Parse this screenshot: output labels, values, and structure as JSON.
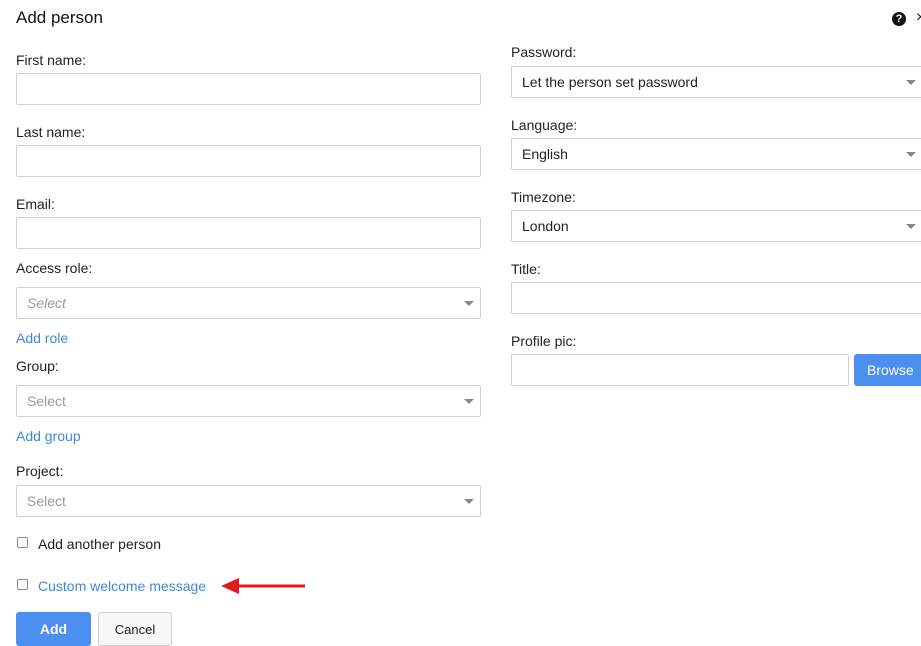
{
  "dialog": {
    "title": "Add person",
    "help_icon": "?",
    "close_icon": "×"
  },
  "left": {
    "first_name_label": "First name:",
    "last_name_label": "Last name:",
    "email_label": "Email:",
    "access_role_label": "Access role:",
    "access_role_placeholder": "Select",
    "add_role_link": "Add role",
    "group_label": "Group:",
    "group_placeholder": "Select",
    "add_group_link": "Add group",
    "project_label": "Project:",
    "project_placeholder": "Select",
    "add_another_label": "Add another person",
    "custom_welcome_label": "Custom welcome message"
  },
  "right": {
    "password_label": "Password:",
    "password_value": "Let the person set password",
    "language_label": "Language:",
    "language_value": "English",
    "timezone_label": "Timezone:",
    "timezone_value": "London",
    "title_label": "Title:",
    "profile_pic_label": "Profile pic:",
    "browse_button": "Browse"
  },
  "footer": {
    "add_button": "Add",
    "cancel_button": "Cancel"
  },
  "colors": {
    "primary": "#4b8ff0",
    "link": "#3f87e0",
    "annotation_arrow": "#e01b1b"
  }
}
